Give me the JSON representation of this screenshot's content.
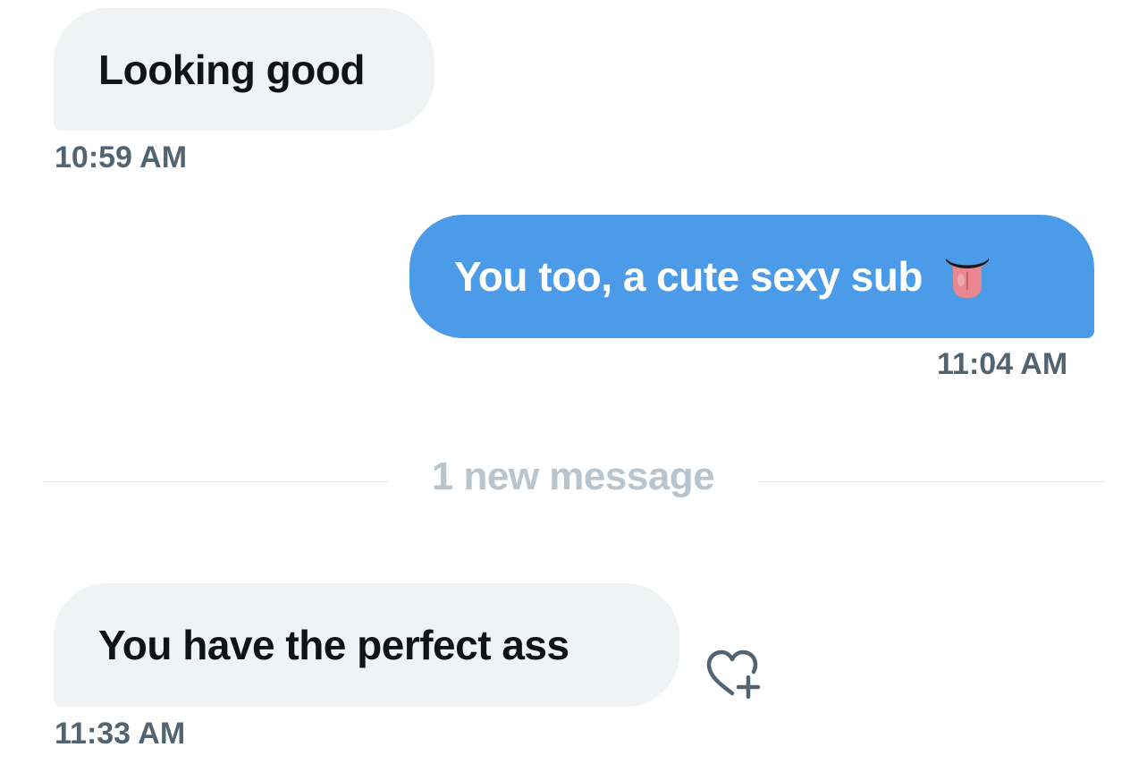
{
  "messages": [
    {
      "text": "Looking good",
      "time": "10:59 AM",
      "direction": "received"
    },
    {
      "text": "You too, a cute sexy sub",
      "emoji": "tongue-face-emoji",
      "time": "11:04 AM",
      "direction": "sent"
    },
    {
      "text": "You have the perfect ass",
      "time": "11:33 AM",
      "direction": "received"
    }
  ],
  "divider": {
    "label": "1 new message"
  },
  "reaction": {
    "icon": "heart-add-icon"
  },
  "colors": {
    "sent_bubble": "#4c9be8",
    "received_bubble": "#eff3f4",
    "timestamp": "#536471",
    "divider_label": "#b8c5cf"
  }
}
